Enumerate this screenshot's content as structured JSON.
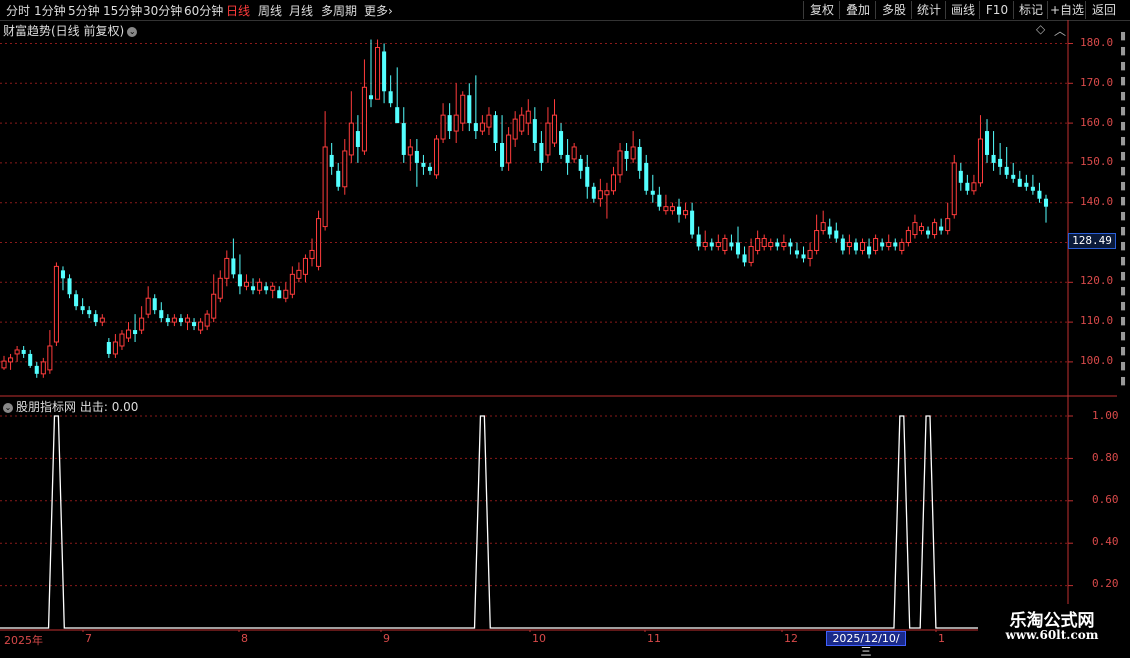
{
  "toolbar": {
    "periods": [
      "分时",
      "1分钟",
      "5分钟",
      "15分钟",
      "30分钟",
      "60分钟",
      "日线",
      "周线",
      "月线",
      "多周期",
      "更多"
    ],
    "active_period": "日线",
    "right_buttons": [
      "复权",
      "叠加",
      "多股",
      "统计",
      "画线",
      "F10",
      "标记",
      "+自选",
      "返回"
    ]
  },
  "main_panel": {
    "title": "财富趋势(日线 前复权)",
    "y_ticks": [
      "180.0",
      "170.0",
      "160.0",
      "150.0",
      "140.0",
      "130.0",
      "120.0",
      "110.0",
      "100.0"
    ],
    "current_price_tag": "128.49",
    "diamond_icon": "◇",
    "chevron_icon": "⌄"
  },
  "indicator_panel": {
    "title": "股朋指标网",
    "label": "出击:",
    "value": "0.00",
    "y_ticks": [
      "1.00",
      "0.80",
      "0.60",
      "0.40",
      "0.20"
    ]
  },
  "x_axis": {
    "labels": [
      "2025年",
      "7",
      "8",
      "9",
      "10",
      "11",
      "12",
      "1"
    ],
    "cursor_date": "2025/12/10/三"
  },
  "watermark": {
    "title": "乐淘公式网",
    "url": "www.60lt.com"
  },
  "colors": {
    "up": "#ff3c3c",
    "down": "#54ffff",
    "grid": "#8a1a1a",
    "axis": "#c03030",
    "signal": "#ffffff"
  },
  "chart_data": [
    {
      "type": "candlestick",
      "title": "财富趋势(日线 前复权)",
      "ylim": [
        95,
        182
      ],
      "candles": [
        [
          98.5,
          100.2,
          98,
          101.5
        ],
        [
          100,
          101,
          98,
          102
        ],
        [
          102,
          103,
          100,
          104
        ],
        [
          103,
          102,
          101,
          104
        ],
        [
          102,
          99,
          98.5,
          103
        ],
        [
          99,
          97,
          96,
          100
        ],
        [
          97,
          100,
          96,
          101
        ],
        [
          98,
          104,
          97,
          108
        ],
        [
          105,
          124,
          104,
          125
        ],
        [
          123,
          121,
          118,
          124
        ],
        [
          121,
          117,
          116,
          122
        ],
        [
          117,
          114,
          113,
          118
        ],
        [
          114,
          113,
          112,
          116
        ],
        [
          113,
          112,
          111,
          114
        ],
        [
          112,
          110,
          109,
          113
        ],
        [
          110,
          111,
          109,
          112
        ],
        [
          105,
          102,
          101,
          106
        ],
        [
          102,
          105,
          101,
          107
        ],
        [
          104,
          107,
          103,
          108
        ],
        [
          106,
          108,
          105,
          110
        ],
        [
          108,
          107,
          105,
          112
        ],
        [
          108,
          111,
          107,
          114
        ],
        [
          112,
          116,
          111,
          119
        ],
        [
          116,
          113,
          112,
          117
        ],
        [
          113,
          111,
          110,
          115
        ],
        [
          111,
          110,
          109,
          112
        ],
        [
          110,
          111,
          109,
          112
        ],
        [
          111,
          110,
          109,
          112
        ],
        [
          110,
          111,
          108,
          112
        ],
        [
          110,
          109,
          108,
          111
        ],
        [
          108,
          110,
          107,
          111
        ],
        [
          109,
          112,
          108,
          113
        ],
        [
          111,
          117,
          110,
          122
        ],
        [
          116,
          121,
          115,
          123
        ],
        [
          121,
          126,
          119,
          128
        ],
        [
          126,
          122,
          121,
          131
        ],
        [
          122,
          119,
          117,
          127
        ],
        [
          119,
          120,
          118,
          122
        ],
        [
          119,
          118,
          117,
          121
        ],
        [
          118,
          120,
          117,
          121
        ],
        [
          119,
          118,
          117,
          120
        ],
        [
          118,
          119,
          116,
          120
        ],
        [
          118,
          116,
          116,
          119
        ],
        [
          116,
          118,
          115,
          120
        ],
        [
          117,
          122,
          116,
          124
        ],
        [
          121,
          123,
          120,
          125
        ],
        [
          122,
          126,
          120,
          127
        ],
        [
          126,
          128,
          124,
          131
        ],
        [
          124,
          136,
          123,
          138
        ],
        [
          134,
          154,
          133,
          163
        ],
        [
          152,
          149,
          147,
          155
        ],
        [
          148,
          144,
          143,
          150
        ],
        [
          144,
          153,
          142,
          156
        ],
        [
          152,
          160,
          150,
          168
        ],
        [
          158,
          154,
          150,
          162
        ],
        [
          153,
          169,
          152,
          176
        ],
        [
          167,
          166,
          164,
          181
        ],
        [
          166,
          179,
          166,
          181
        ],
        [
          178,
          168,
          165,
          180
        ],
        [
          168,
          165,
          164,
          172
        ],
        [
          164,
          160,
          160,
          174
        ],
        [
          160,
          152,
          150,
          164
        ],
        [
          152,
          154,
          148,
          156
        ],
        [
          153,
          150,
          144,
          156
        ],
        [
          150,
          149,
          147,
          152
        ],
        [
          149,
          148,
          147,
          150
        ],
        [
          147,
          156,
          146,
          157
        ],
        [
          156,
          162,
          155,
          165
        ],
        [
          162,
          158,
          156,
          165
        ],
        [
          158,
          162,
          155,
          170
        ],
        [
          160,
          167,
          158,
          168
        ],
        [
          167,
          160,
          158,
          170
        ],
        [
          160,
          158,
          156,
          172
        ],
        [
          158,
          160,
          157,
          162
        ],
        [
          159,
          162,
          157,
          164
        ],
        [
          162,
          155,
          153,
          163
        ],
        [
          155,
          149,
          148,
          162
        ],
        [
          150,
          157,
          148,
          159
        ],
        [
          156,
          161,
          154,
          163
        ],
        [
          158,
          162,
          157,
          164
        ],
        [
          160,
          163,
          157,
          166
        ],
        [
          161,
          155,
          153,
          164
        ],
        [
          155,
          150,
          148,
          158
        ],
        [
          152,
          160,
          150,
          164
        ],
        [
          155,
          162,
          154,
          166
        ],
        [
          158,
          152,
          151,
          160
        ],
        [
          152,
          150,
          147,
          156
        ],
        [
          151,
          154,
          150,
          155
        ],
        [
          151,
          148,
          146,
          152
        ],
        [
          149,
          144,
          141,
          152
        ],
        [
          144,
          141,
          140,
          145
        ],
        [
          141,
          143,
          139,
          146
        ],
        [
          142,
          143,
          136,
          145
        ],
        [
          143,
          147,
          142,
          149
        ],
        [
          147,
          153,
          145,
          155
        ],
        [
          153,
          151,
          148,
          155
        ],
        [
          151,
          154,
          150,
          158
        ],
        [
          154,
          148,
          146,
          156
        ],
        [
          150,
          143,
          142,
          152
        ],
        [
          143,
          142,
          140,
          147
        ],
        [
          142,
          139,
          138,
          144
        ],
        [
          138,
          139,
          137,
          142
        ],
        [
          138,
          139,
          137,
          140
        ],
        [
          139,
          137,
          135,
          141
        ],
        [
          137,
          138,
          136,
          140
        ],
        [
          138,
          132,
          131,
          140
        ],
        [
          132,
          129,
          128,
          134
        ],
        [
          129,
          130,
          128,
          133
        ],
        [
          130,
          129,
          128,
          131
        ],
        [
          129,
          130,
          128,
          132
        ],
        [
          128,
          131,
          127,
          132
        ],
        [
          130,
          129,
          128,
          132
        ],
        [
          130,
          127,
          126,
          134
        ],
        [
          127,
          125,
          124,
          129
        ],
        [
          125,
          129,
          124,
          131
        ],
        [
          128,
          131,
          127,
          133
        ],
        [
          129,
          131,
          128,
          132
        ],
        [
          129,
          130,
          128,
          131
        ],
        [
          130,
          129,
          128,
          131
        ],
        [
          129,
          130,
          128,
          132
        ],
        [
          130,
          129,
          127,
          131
        ],
        [
          128,
          127,
          126,
          130
        ],
        [
          127,
          126,
          125,
          129
        ],
        [
          126,
          128,
          124,
          130
        ],
        [
          128,
          133,
          127,
          137
        ],
        [
          133,
          135,
          132,
          138
        ],
        [
          134,
          132,
          131,
          136
        ],
        [
          133,
          131,
          130,
          135
        ],
        [
          131,
          128,
          127,
          132
        ],
        [
          129,
          130,
          127,
          132
        ],
        [
          130,
          128,
          127,
          131
        ],
        [
          128,
          130,
          127,
          131
        ],
        [
          129,
          127,
          126,
          131
        ],
        [
          128,
          131,
          127,
          132
        ],
        [
          130,
          129,
          128,
          131
        ],
        [
          129,
          130,
          128,
          132
        ],
        [
          130,
          129,
          128,
          131
        ],
        [
          128,
          130,
          127,
          131
        ],
        [
          130,
          133,
          129,
          134
        ],
        [
          132,
          135,
          131,
          137
        ],
        [
          133,
          134,
          132,
          135
        ],
        [
          133,
          132,
          131,
          134
        ],
        [
          132,
          135,
          131,
          136
        ],
        [
          134,
          133,
          132,
          136
        ],
        [
          133,
          136,
          132,
          140
        ],
        [
          137,
          150,
          136,
          152
        ],
        [
          148,
          145,
          143,
          150
        ],
        [
          145,
          143,
          142,
          147
        ],
        [
          143,
          145,
          142,
          147
        ],
        [
          145,
          156,
          144,
          162
        ],
        [
          158,
          152,
          150,
          161
        ],
        [
          152,
          150,
          148,
          158
        ],
        [
          151,
          149,
          147,
          155
        ],
        [
          149,
          147,
          146,
          154
        ],
        [
          147,
          146,
          145,
          150
        ],
        [
          146,
          144,
          144,
          148
        ],
        [
          145,
          144,
          143,
          147
        ],
        [
          144,
          143,
          142,
          147
        ],
        [
          143,
          141,
          140,
          145
        ],
        [
          141,
          139,
          135,
          142
        ]
      ]
    },
    {
      "type": "line",
      "name": "出击",
      "ylim": [
        0,
        1.05
      ],
      "signal_positions": [
        8,
        73,
        137,
        141
      ],
      "n": 147
    }
  ]
}
